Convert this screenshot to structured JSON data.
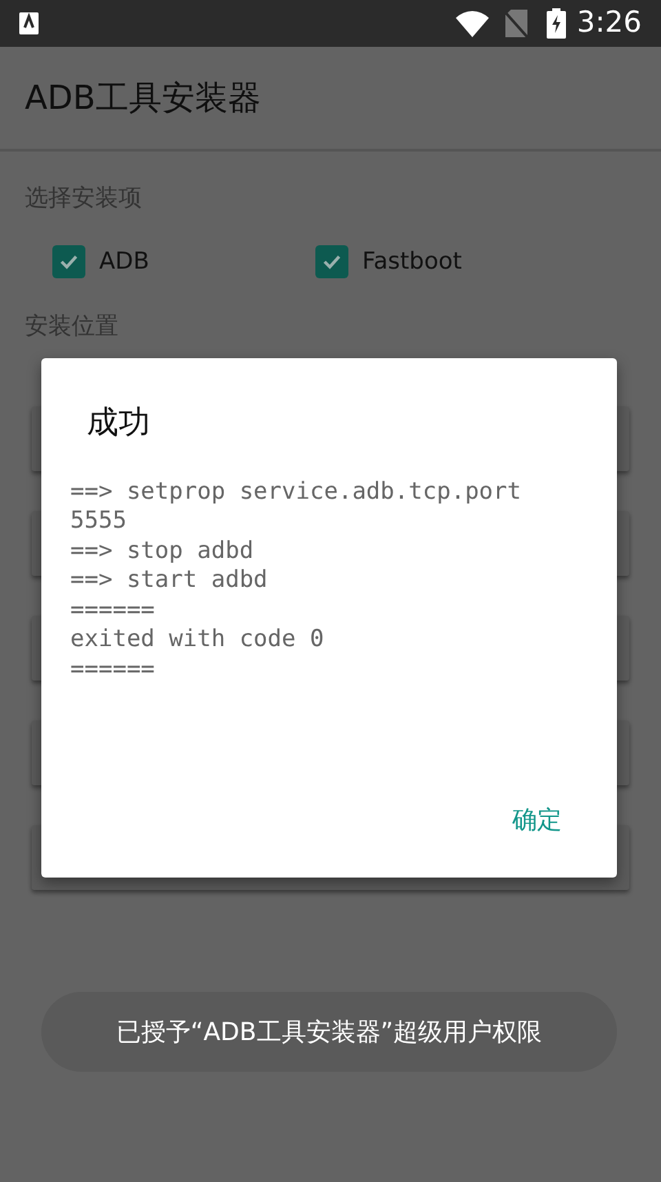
{
  "status_bar": {
    "time": "3:26"
  },
  "app_bar": {
    "title": "ADB工具安装器"
  },
  "section_title": "选择安装项",
  "options": [
    {
      "label": "ADB",
      "checked": true
    },
    {
      "label": "Fastboot",
      "checked": true
    }
  ],
  "location_label": "安装位置",
  "dialog": {
    "title": "成功",
    "lines": [
      "==> setprop service.adb.tcp.port",
      "5555",
      "==> stop adbd",
      "==> start adbd",
      "======",
      "exited with code 0",
      "======"
    ],
    "button": "确定"
  },
  "toast": "已授予“ADB工具安装器”超级用户权限"
}
